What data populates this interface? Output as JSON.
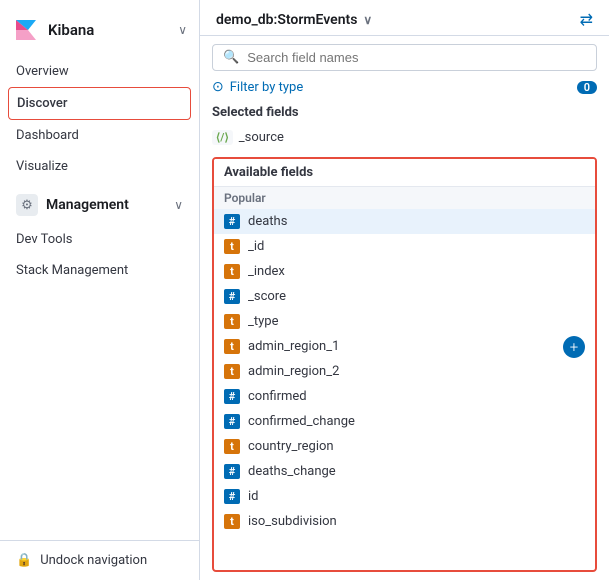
{
  "sidebar": {
    "logo_text": "Kibana",
    "chevron": "∨",
    "nav_items": [
      {
        "label": "Overview",
        "active": false
      },
      {
        "label": "Discover",
        "active": true
      },
      {
        "label": "Dashboard",
        "active": false
      },
      {
        "label": "Visualize",
        "active": false
      }
    ],
    "management_label": "Management",
    "management_subitems": [
      {
        "label": "Dev Tools"
      },
      {
        "label": "Stack Management"
      }
    ],
    "undock_label": "Undock navigation"
  },
  "header": {
    "db_name": "demo_db:StormEvents",
    "chevron": "∨"
  },
  "search": {
    "placeholder": "Search field names"
  },
  "filter": {
    "label": "Filter by type",
    "count": "0"
  },
  "selected_fields": {
    "title": "Selected fields",
    "items": [
      {
        "type_icon": "⟨/⟩",
        "name": "_source"
      }
    ]
  },
  "available_fields": {
    "title": "Available fields",
    "popular_label": "Popular",
    "items": [
      {
        "type": "hash",
        "name": "deaths",
        "highlighted": true,
        "show_add": false
      },
      {
        "type": "t",
        "name": "_id",
        "highlighted": false,
        "show_add": false
      },
      {
        "type": "t",
        "name": "_index",
        "highlighted": false,
        "show_add": false
      },
      {
        "type": "hash",
        "name": "_score",
        "highlighted": false,
        "show_add": false
      },
      {
        "type": "t",
        "name": "_type",
        "highlighted": false,
        "show_add": false
      },
      {
        "type": "t",
        "name": "admin_region_1",
        "highlighted": false,
        "show_add": true
      },
      {
        "type": "t",
        "name": "admin_region_2",
        "highlighted": false,
        "show_add": false
      },
      {
        "type": "hash",
        "name": "confirmed",
        "highlighted": false,
        "show_add": false
      },
      {
        "type": "hash",
        "name": "confirmed_change",
        "highlighted": false,
        "show_add": false
      },
      {
        "type": "t",
        "name": "country_region",
        "highlighted": false,
        "show_add": false
      },
      {
        "type": "hash",
        "name": "deaths_change",
        "highlighted": false,
        "show_add": false
      },
      {
        "type": "hash",
        "name": "id",
        "highlighted": false,
        "show_add": false
      },
      {
        "type": "t",
        "name": "iso_subdivision",
        "highlighted": false,
        "show_add": false
      }
    ]
  }
}
